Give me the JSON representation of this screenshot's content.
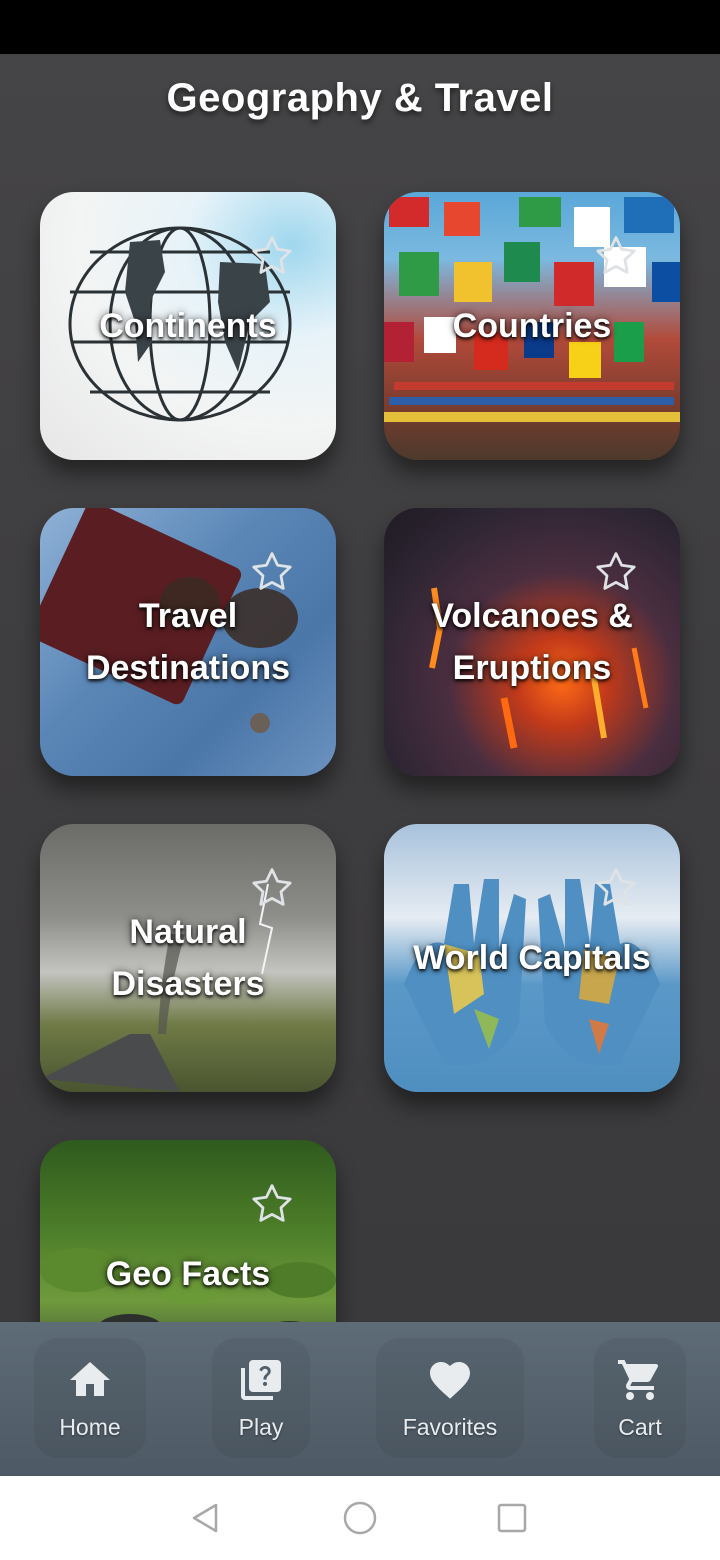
{
  "header": {
    "title": "Geography & Travel"
  },
  "cards": [
    {
      "label": "Continents",
      "icon": "star-outline-icon"
    },
    {
      "label": "Countries",
      "icon": "star-outline-icon"
    },
    {
      "label_line1": "Travel",
      "label_line2": "Destinations",
      "icon": "star-outline-icon"
    },
    {
      "label_line1": "Volcanoes &",
      "label_line2": "Eruptions",
      "icon": "star-outline-icon"
    },
    {
      "label_line1": "Natural",
      "label_line2": "Disasters",
      "icon": "star-outline-icon"
    },
    {
      "label": "World Capitals",
      "icon": "star-outline-icon"
    },
    {
      "label": "Geo Facts",
      "icon": "star-outline-icon"
    }
  ],
  "bottom_nav": {
    "items": [
      {
        "label": "Home",
        "icon": "home-icon"
      },
      {
        "label": "Play",
        "icon": "quiz-icon"
      },
      {
        "label": "Favorites",
        "icon": "heart-icon"
      },
      {
        "label": "Cart",
        "icon": "cart-icon"
      }
    ]
  },
  "system_nav": {
    "icons": [
      "back-icon",
      "home-circle-icon",
      "recents-icon"
    ]
  },
  "colors": {
    "background": "#3f3e40",
    "bottom_nav": "#56636e",
    "title_text": "#ffffff"
  }
}
